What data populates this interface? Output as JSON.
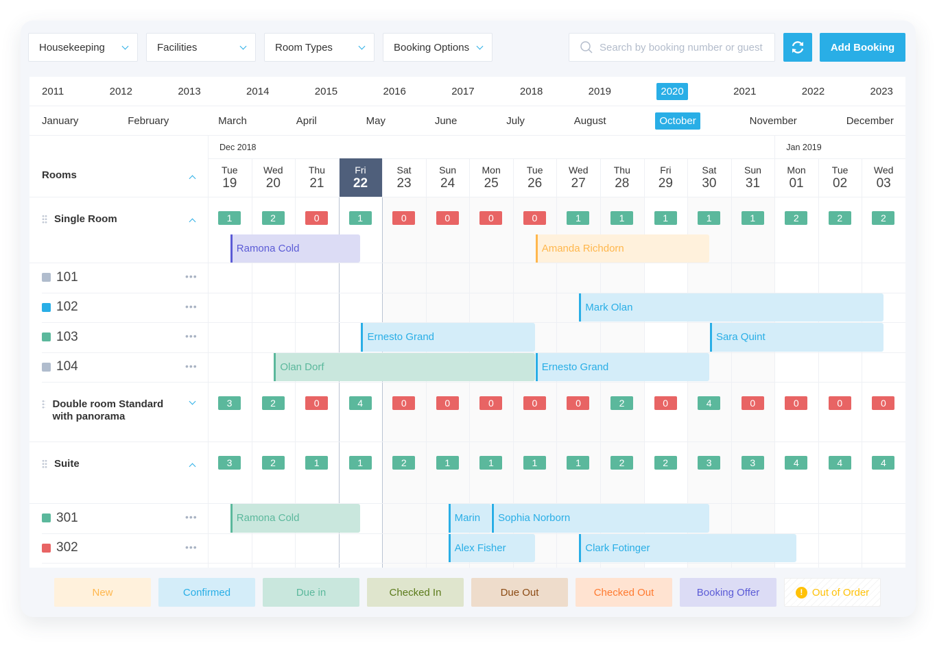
{
  "toolbar": {
    "dropdowns": [
      "Housekeeping",
      "Facilities",
      "Room Types",
      "Booking Options"
    ],
    "search_placeholder": "Search by booking number or guest",
    "search_value": "",
    "refresh_icon": "refresh-icon",
    "add_booking": "Add Booking",
    "accent": "#29aee6"
  },
  "years": {
    "items": [
      "2011",
      "2012",
      "2013",
      "2014",
      "2015",
      "2016",
      "2017",
      "2018",
      "2019",
      "2020",
      "2021",
      "2022",
      "2023"
    ],
    "selected": "2020"
  },
  "months": {
    "items": [
      "January",
      "February",
      "March",
      "April",
      "May",
      "June",
      "July",
      "August",
      "October",
      "November",
      "December"
    ],
    "selected": "October"
  },
  "calendar": {
    "rooms_label": "Rooms",
    "month_labels": [
      {
        "label": "Dec 2018",
        "month": "Dec"
      },
      {
        "label": "Jan 2019",
        "month": "Jan"
      }
    ],
    "today": "Dec 22",
    "days": [
      {
        "dow": "Tue",
        "day": "19",
        "month": "Dec"
      },
      {
        "dow": "Wed",
        "day": "20",
        "month": "Dec"
      },
      {
        "dow": "Thu",
        "day": "21",
        "month": "Dec"
      },
      {
        "dow": "Fri",
        "day": "22",
        "month": "Dec"
      },
      {
        "dow": "Sat",
        "day": "23",
        "month": "Dec"
      },
      {
        "dow": "Sun",
        "day": "24",
        "month": "Dec"
      },
      {
        "dow": "Mon",
        "day": "25",
        "month": "Dec"
      },
      {
        "dow": "Tue",
        "day": "26",
        "month": "Dec"
      },
      {
        "dow": "Wed",
        "day": "27",
        "month": "Dec"
      },
      {
        "dow": "Thu",
        "day": "28",
        "month": "Dec"
      },
      {
        "dow": "Fri",
        "day": "29",
        "month": "Dec"
      },
      {
        "dow": "Sat",
        "day": "30",
        "month": "Dec"
      },
      {
        "dow": "Sun",
        "day": "31",
        "month": "Dec"
      },
      {
        "dow": "Mon",
        "day": "01",
        "month": "Jan"
      },
      {
        "dow": "Tue",
        "day": "02",
        "month": "Jan"
      },
      {
        "dow": "Wed",
        "day": "03",
        "month": "Jan"
      }
    ],
    "groups": [
      {
        "name": "Single Room",
        "expanded": true,
        "availability": [
          1,
          2,
          0,
          1,
          0,
          0,
          0,
          0,
          1,
          1,
          1,
          1,
          1,
          2,
          2,
          2
        ],
        "unassigned": [
          {
            "guest": "Ramona Cold",
            "status": "Booking Offer",
            "in": "Dec 19",
            "out": "Dec 22"
          },
          {
            "guest": "Amanda Richdorn",
            "status": "New",
            "in": "Dec 26",
            "out": "Dec 30"
          }
        ],
        "rooms": [
          {
            "number": "101",
            "color": "#b0bccd",
            "bookings": []
          },
          {
            "number": "102",
            "color": "#29aee6",
            "bookings": [
              {
                "guest": "Mark Olan",
                "status": "Confirmed",
                "in": "Dec 27",
                "out": "Jan 03"
              }
            ]
          },
          {
            "number": "103",
            "color": "#5bb89c",
            "bookings": [
              {
                "guest": "Ernesto Grand",
                "status": "Confirmed",
                "in": "Dec 22",
                "out": "Dec 26"
              },
              {
                "guest": "Sara Quint",
                "status": "Confirmed",
                "in": "Dec 30",
                "out": "Jan 03"
              }
            ]
          },
          {
            "number": "104",
            "color": "#b0bccd",
            "bookings": [
              {
                "guest": "Olan Dorf",
                "status": "Due in",
                "in": "Dec 20",
                "out": "Dec 26"
              },
              {
                "guest": "Ernesto Grand",
                "status": "Confirmed",
                "in": "Dec 26",
                "out": "Dec 30"
              }
            ]
          }
        ]
      },
      {
        "name": "Double room Standard with panorama",
        "expanded": false,
        "availability": [
          3,
          2,
          0,
          4,
          0,
          0,
          0,
          0,
          0,
          2,
          0,
          4,
          0,
          0,
          0,
          0
        ],
        "unassigned": [],
        "rooms": []
      },
      {
        "name": "Suite",
        "expanded": true,
        "availability": [
          3,
          2,
          1,
          1,
          2,
          1,
          1,
          1,
          1,
          2,
          2,
          3,
          3,
          4,
          4,
          4
        ],
        "unassigned": [],
        "rooms": [
          {
            "number": "301",
            "color": "#5bb89c",
            "bookings": [
              {
                "guest": "Ramona Cold",
                "status": "Due in",
                "in": "Dec 19",
                "out": "Dec 22"
              },
              {
                "guest": "Marin",
                "status": "Confirmed",
                "in": "Dec 24",
                "out": "Dec 25"
              },
              {
                "guest": "Sophia Norborn",
                "status": "Confirmed",
                "in": "Dec 25",
                "out": "Dec 30"
              }
            ]
          },
          {
            "number": "302",
            "color": "#e86464",
            "bookings": [
              {
                "guest": "Alex Fisher",
                "status": "Confirmed",
                "in": "Dec 24",
                "out": "Dec 26"
              },
              {
                "guest": "Clark Fotinger",
                "status": "Confirmed",
                "in": "Dec 27",
                "out": "Jan 01"
              }
            ]
          }
        ]
      }
    ],
    "available_color": "#5bb89c",
    "unavailable_color": "#e86464"
  },
  "legend": [
    {
      "label": "New",
      "bg": "#fff1dc",
      "fg": "#ffb74d",
      "border": "#ffb74d"
    },
    {
      "label": "Confirmed",
      "bg": "#d4edf9",
      "fg": "#29aee6",
      "border": "#29aee6"
    },
    {
      "label": "Due in",
      "bg": "#c9e7dd",
      "fg": "#5bb89c",
      "border": "#5bb89c"
    },
    {
      "label": "Checked In",
      "bg": "#dfe5cd",
      "fg": "#5b7a1a",
      "border": "#5b7a1a"
    },
    {
      "label": "Due Out",
      "bg": "#eedccb",
      "fg": "#8b4a13",
      "border": "#8b4a13"
    },
    {
      "label": "Checked Out",
      "bg": "#ffe3d1",
      "fg": "#ff7a30",
      "border": "#ff7a30"
    },
    {
      "label": "Booking Offer",
      "bg": "#dcdcf5",
      "fg": "#5b5bd6",
      "border": "#5b5bd6"
    },
    {
      "label": "Out of Order",
      "bg": "#ffffff",
      "fg": "#ffc107",
      "border": "#ffc107",
      "icon": "warning-icon"
    }
  ]
}
